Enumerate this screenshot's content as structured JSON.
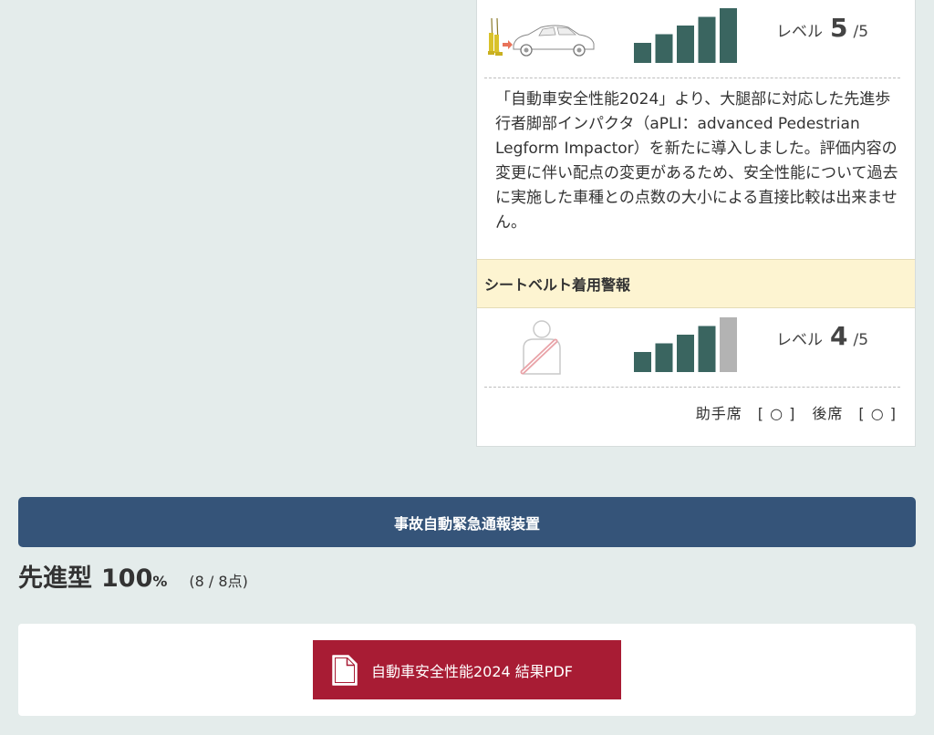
{
  "ped_legform": {
    "level": "5",
    "denominator": "/5",
    "level_label": "レベル",
    "bars_filled": 5,
    "bars_total": 5,
    "note": "「自動車安全性能2024」より、大腿部に対応した先進歩行者脚部インパクタ（aPLI：advanced Pedestrian Legform Impactor）を新たに導入しました。評価内容の変更に伴い配点の変更があるため、安全性能について過去に実施した車種との点数の大小による直接比較は出来ません。"
  },
  "seatbelt": {
    "title": "シートベルト着用警報",
    "level_label": "レベル",
    "level": "4",
    "denominator": "/5",
    "bars_filled": 4,
    "bars_total": 5,
    "seats": [
      "助手席　[ ○ ]",
      "後席　[ ○ ]"
    ]
  },
  "ecall": {
    "banner": "事故自動緊急通報装置",
    "type_label": "先進型",
    "percent_value": "100",
    "percent_sign": "%",
    "points": "(8 / 8点)"
  },
  "pdf_button": {
    "label": "自動車安全性能2024 結果PDF"
  },
  "colors": {
    "bar_on": "#3a6560",
    "bar_off": "#b3b3b3",
    "banner": "#355479",
    "pdf_button": "#a81c34",
    "section_head": "#fdf4d1"
  },
  "icons": {
    "legform": "pedestrian-legform-car-icon",
    "seatbelt": "seatbelt-person-icon",
    "pdf": "document-icon"
  }
}
